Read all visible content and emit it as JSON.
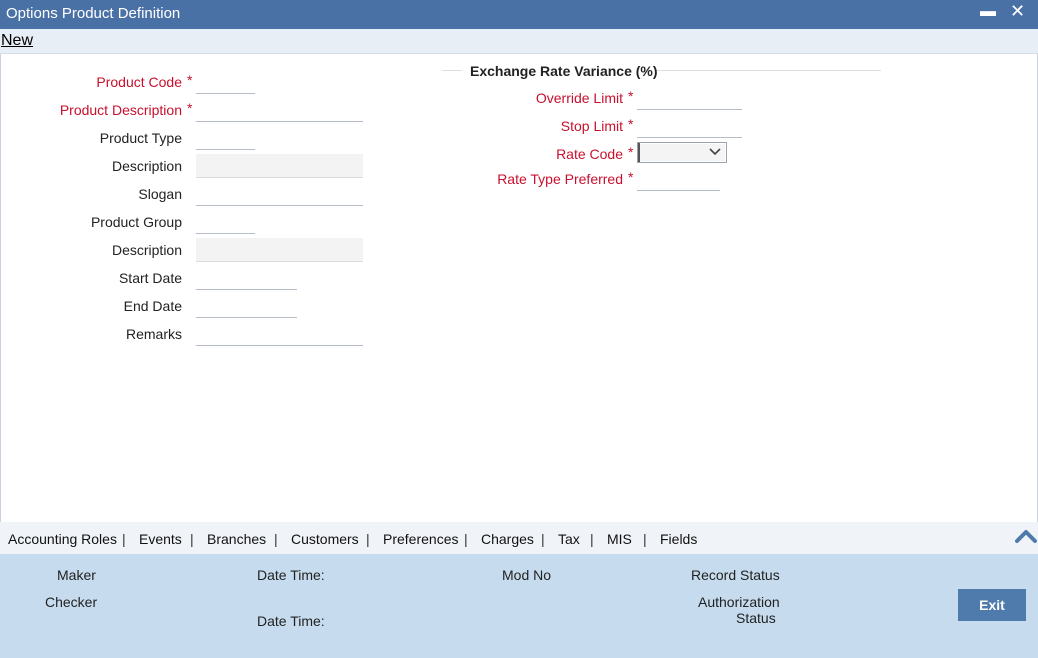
{
  "window": {
    "title": "Options Product Definition",
    "minimize_glyph": "▬",
    "close_glyph": "✕"
  },
  "menu": {
    "new_label": "New"
  },
  "left_form": {
    "product_code": {
      "label": "Product Code",
      "required": "*",
      "value": ""
    },
    "product_description": {
      "label": "Product Description",
      "required": "*",
      "value": ""
    },
    "product_type": {
      "label": "Product Type",
      "value": ""
    },
    "description_1": {
      "label": "Description",
      "value": ""
    },
    "slogan": {
      "label": "Slogan",
      "value": ""
    },
    "product_group": {
      "label": "Product Group",
      "value": ""
    },
    "description_2": {
      "label": "Description",
      "value": ""
    },
    "start_date": {
      "label": "Start Date",
      "value": ""
    },
    "end_date": {
      "label": "End Date",
      "value": ""
    },
    "remarks": {
      "label": "Remarks",
      "value": ""
    }
  },
  "exchange_rate": {
    "section_title": "Exchange Rate Variance (%)",
    "override_limit": {
      "label": "Override Limit",
      "required": "*",
      "value": ""
    },
    "stop_limit": {
      "label": "Stop Limit",
      "required": "*",
      "value": ""
    },
    "rate_code": {
      "label": "Rate Code",
      "required": "*",
      "selected": ""
    },
    "rate_type_preferred": {
      "label": "Rate Type Preferred",
      "required": "*",
      "value": ""
    }
  },
  "tabs": [
    "Accounting Roles",
    "Events",
    "Branches",
    "Customers",
    "Preferences",
    "Charges",
    "Tax",
    "MIS",
    "Fields"
  ],
  "tab_separator": "|",
  "status": {
    "maker": "Maker",
    "checker": "Checker",
    "date_time_1": "Date Time:",
    "date_time_2": "Date Time:",
    "mod_no": "Mod No",
    "record_status": "Record Status",
    "authorization_line1": "Authorization",
    "authorization_line2": "Status",
    "exit_label": "Exit"
  },
  "colors": {
    "titlebar": "#4a71a6",
    "required": "#c8102e",
    "statusbar": "#c6dcee",
    "exit_button": "#4e7bab",
    "collapse_icon": "#4e7bab"
  }
}
